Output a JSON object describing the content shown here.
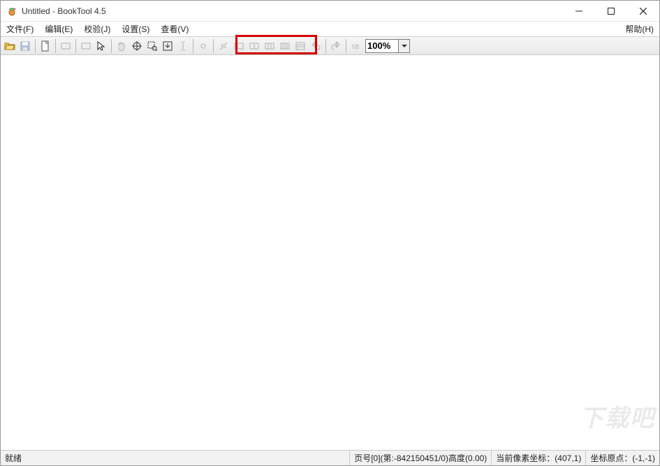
{
  "titlebar": {
    "title": "Untitled - BookTool 4.5"
  },
  "menu": {
    "file": "文件(F)",
    "edit": "编辑(E)",
    "verify": "校验(J)",
    "settings": "设置(S)",
    "view": "查看(V)",
    "help": "帮助(H)"
  },
  "toolbar": {
    "zoom_value": "100%"
  },
  "status": {
    "ready": "就绪",
    "page_info": "页号[0](第:-842150451/0)高度(0.00)",
    "cursor": "当前像素坐标：(407,1)",
    "origin": "坐标原点：(-1,-1)"
  },
  "icons": {
    "open": "open-icon",
    "save": "save-icon",
    "new": "new-page-icon",
    "rect1": "rect-icon",
    "rect2": "rect-icon",
    "pointer": "pointer-icon",
    "hand": "hand-icon",
    "target": "crosshair-icon",
    "zoomregion": "zoom-region-icon",
    "insert": "insert-down-icon",
    "textcursor": "text-cursor-icon",
    "link1": "link-icon",
    "link2": "link-break-icon",
    "grid1": "column-1-icon",
    "grid2": "column-2-icon",
    "grid3": "column-3-icon",
    "grid4": "column-4-icon",
    "grid5": "column-5-icon",
    "undo": "undo-icon",
    "redo": "redo-icon",
    "num": "num-icon"
  }
}
